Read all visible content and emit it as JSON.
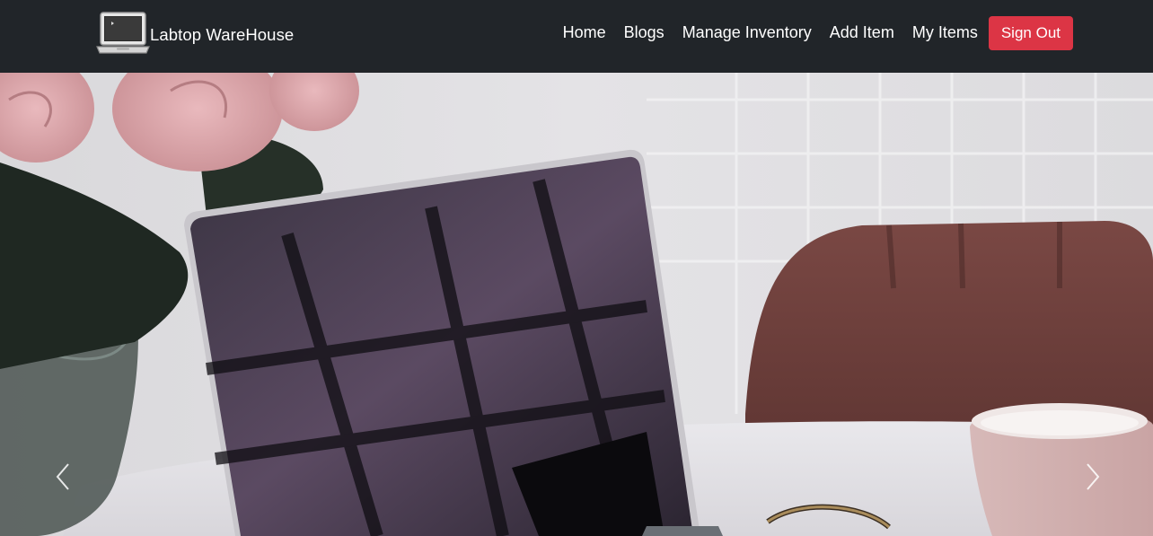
{
  "header": {
    "brand": {
      "name": "Labtop WareHouse",
      "logo_icon": "laptop-icon"
    },
    "nav": [
      {
        "label": "Home"
      },
      {
        "label": "Blogs"
      },
      {
        "label": "Manage Inventory"
      },
      {
        "label": "Add Item"
      },
      {
        "label": "My Items"
      }
    ],
    "signout_label": "Sign Out"
  },
  "hero": {
    "image_icon": "hero-photo",
    "prev_icon": "chevron-left-icon",
    "next_icon": "chevron-right-icon"
  },
  "colors": {
    "navbar_bg": "#212529",
    "signout_bg": "#dc3545",
    "text_light": "#ffffff"
  }
}
